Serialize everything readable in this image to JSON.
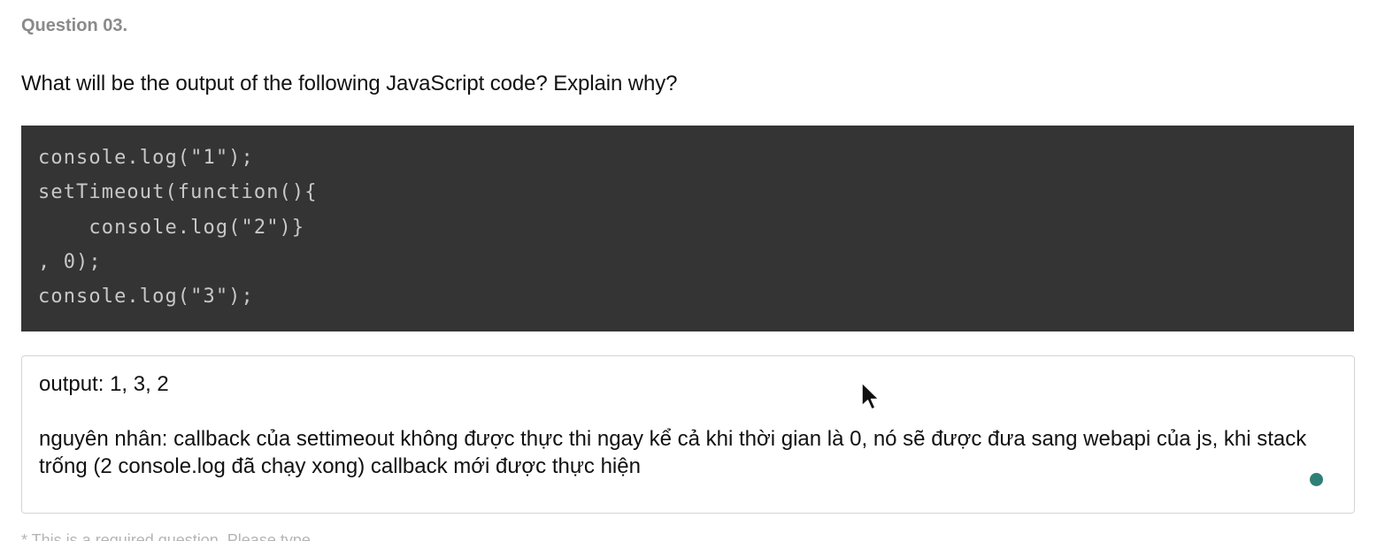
{
  "question": {
    "number": "Question 03.",
    "prompt": "What will be the output of the following JavaScript code? Explain why?"
  },
  "code": {
    "lines": [
      "console.log(\"1\");",
      "setTimeout(function(){",
      "    console.log(\"2\")}",
      ", 0);",
      "console.log(\"3\");"
    ]
  },
  "answer": {
    "line1": "output: 1, 3, 2",
    "line2": "nguyên nhân:  callback của settimeout không được thực thi ngay kể cả khi thời gian là 0, nó sẽ được đưa sang webapi của js, khi stack trống (2 console.log đã chạy xong) callback mới được thực hiện"
  },
  "footnote": "* This is a required question. Please type",
  "colors": {
    "code_background": "#343434",
    "code_text": "#c8c8c8",
    "status_dot": "#2e8077"
  },
  "icons": {
    "cursor": "mouse-pointer-icon",
    "status": "status-dot-icon"
  }
}
